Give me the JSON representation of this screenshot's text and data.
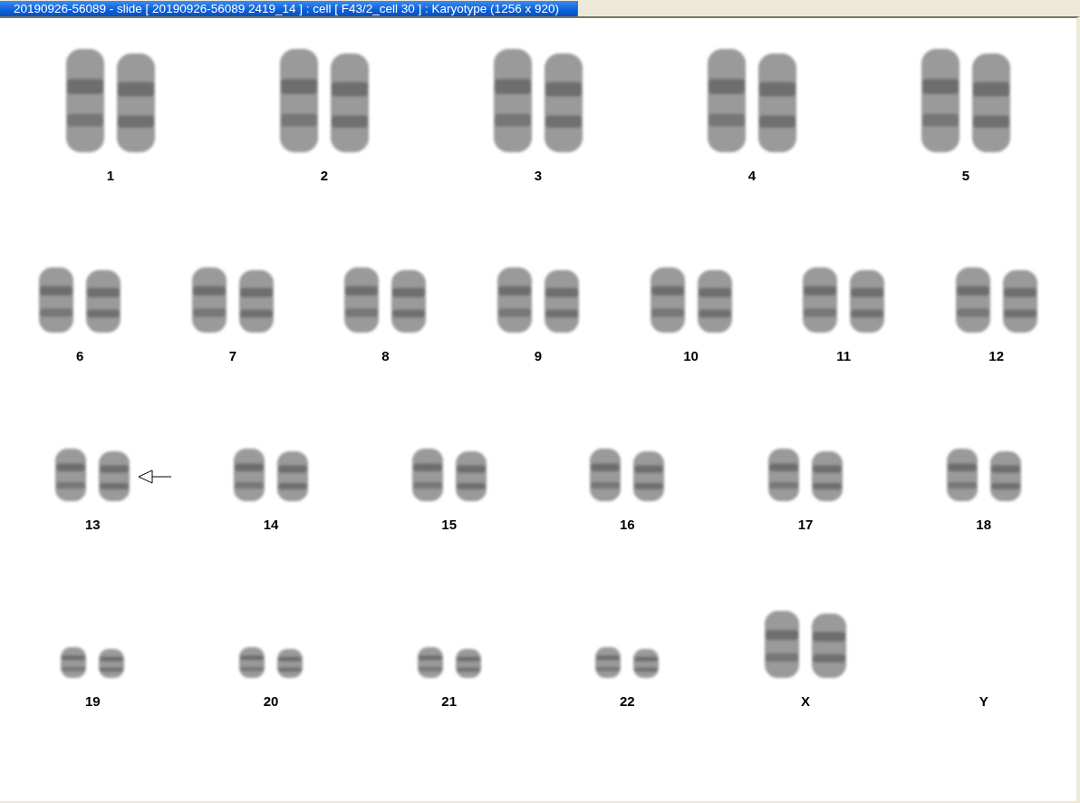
{
  "window": {
    "title": "20190926-56089 - slide [ 20190926-56089 2419_14 ] : cell [ F43/2_cell 30 ] : Karyotype  (1256 x 920)"
  },
  "karyotype": {
    "rows": [
      {
        "pairs": [
          {
            "label": "1",
            "kind": "pair",
            "marked": false
          },
          {
            "label": "2",
            "kind": "pair",
            "marked": false
          },
          {
            "label": "3",
            "kind": "pair",
            "marked": false
          },
          {
            "label": "4",
            "kind": "pair",
            "marked": false
          },
          {
            "label": "5",
            "kind": "pair",
            "marked": false
          }
        ]
      },
      {
        "pairs": [
          {
            "label": "6",
            "kind": "pair",
            "marked": false
          },
          {
            "label": "7",
            "kind": "pair",
            "marked": false
          },
          {
            "label": "8",
            "kind": "pair",
            "marked": false
          },
          {
            "label": "9",
            "kind": "pair",
            "marked": false
          },
          {
            "label": "10",
            "kind": "pair",
            "marked": false
          },
          {
            "label": "11",
            "kind": "pair",
            "marked": false
          },
          {
            "label": "12",
            "kind": "pair",
            "marked": false
          }
        ]
      },
      {
        "pairs": [
          {
            "label": "13",
            "kind": "pair",
            "marked": true
          },
          {
            "label": "14",
            "kind": "pair",
            "marked": false
          },
          {
            "label": "15",
            "kind": "pair",
            "marked": false
          },
          {
            "label": "16",
            "kind": "pair",
            "marked": false
          },
          {
            "label": "17",
            "kind": "pair",
            "marked": false
          },
          {
            "label": "18",
            "kind": "pair",
            "marked": false
          }
        ]
      },
      {
        "pairs": [
          {
            "label": "19",
            "kind": "pair",
            "marked": false
          },
          {
            "label": "20",
            "kind": "pair",
            "marked": false
          },
          {
            "label": "21",
            "kind": "pair",
            "marked": false
          },
          {
            "label": "22",
            "kind": "pair",
            "marked": false
          },
          {
            "label": "X",
            "kind": "pair",
            "marked": false
          },
          {
            "label": "Y",
            "kind": "empty",
            "marked": false
          }
        ]
      }
    ]
  }
}
